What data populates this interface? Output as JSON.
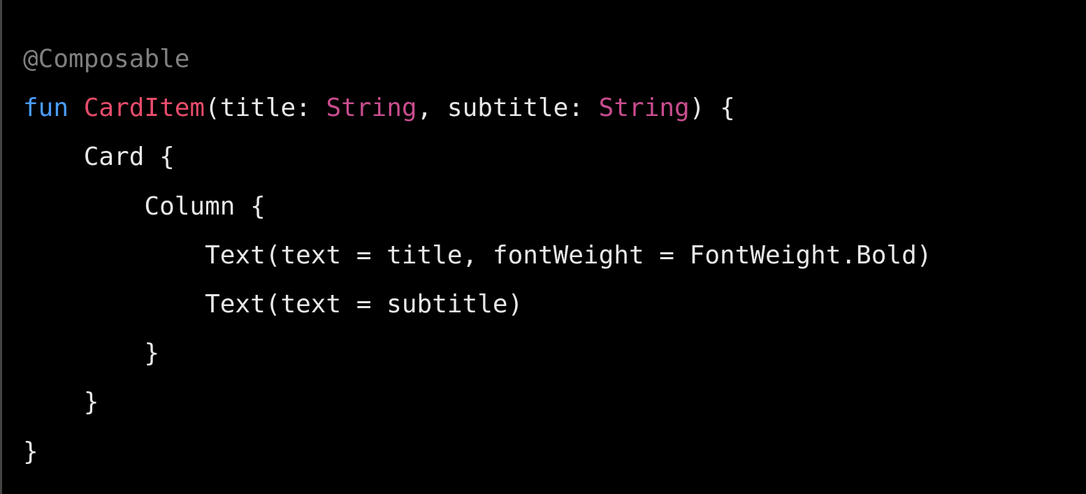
{
  "code": {
    "line1": {
      "annotation": "@Composable"
    },
    "line2": {
      "keyword": "fun",
      "space1": " ",
      "funcName": "CardItem",
      "paren1": "(",
      "param1": "title: ",
      "type1": "String",
      "comma": ", ",
      "param2": "subtitle: ",
      "type2": "String",
      "close": ") {"
    },
    "line3": {
      "text": "    Card {"
    },
    "line4": {
      "text": "        Column {"
    },
    "line5": {
      "text": "            Text(text = title, fontWeight = FontWeight.Bold)"
    },
    "line6": {
      "text": "            Text(text = subtitle)"
    },
    "line7": {
      "text": "        }"
    },
    "line8": {
      "text": "    }"
    },
    "line9": {
      "text": "}"
    }
  }
}
